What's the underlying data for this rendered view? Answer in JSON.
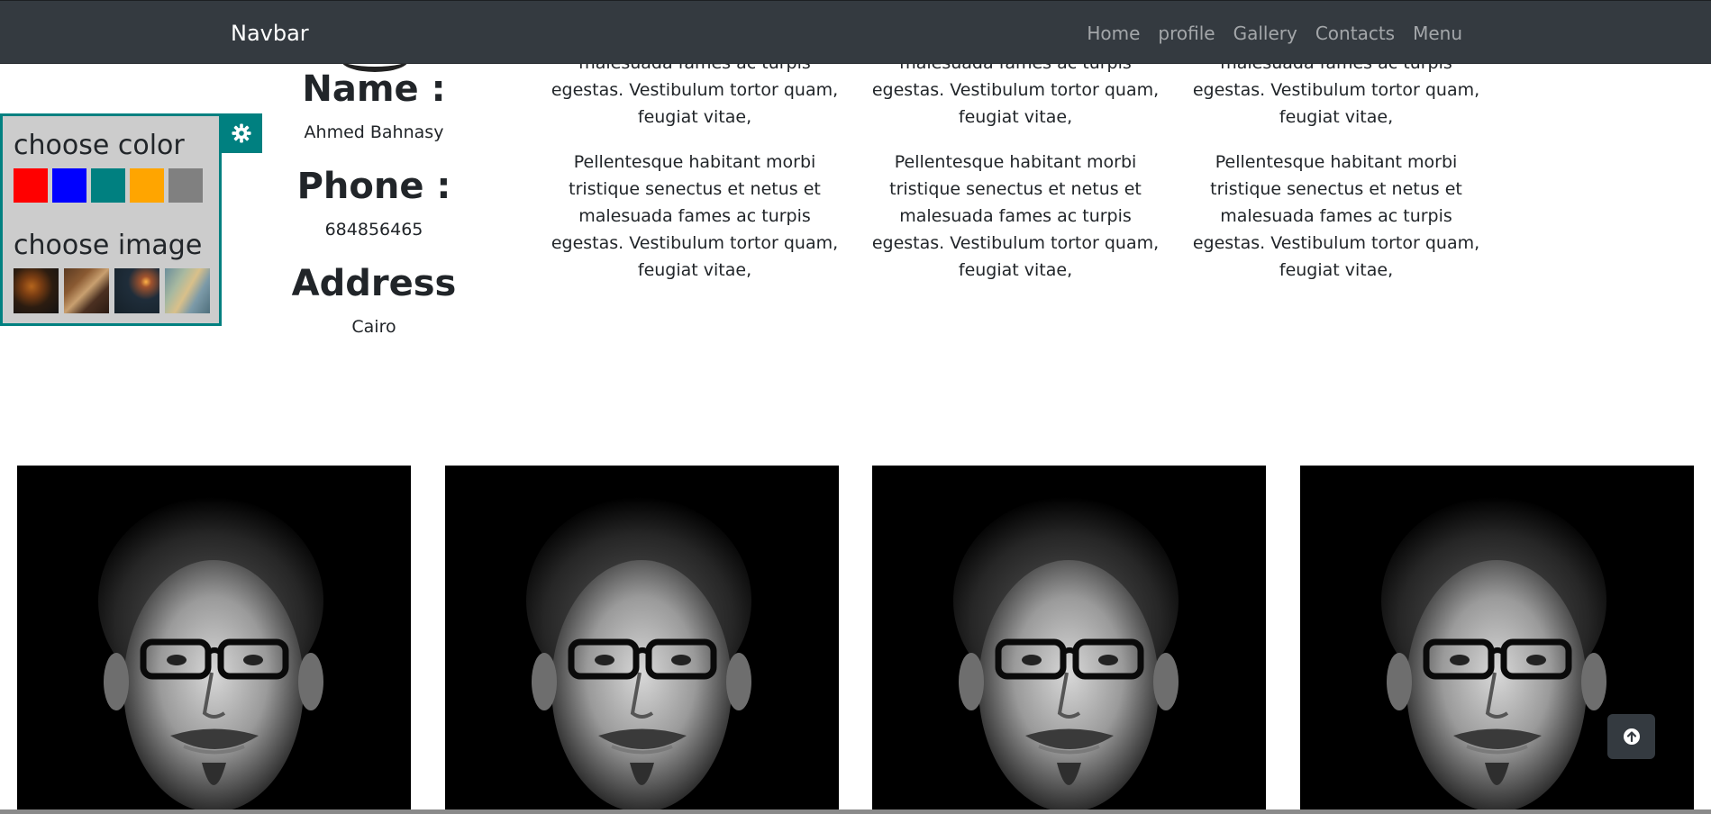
{
  "navbar": {
    "brand": "Navbar",
    "links": [
      "Home",
      "profile",
      "Gallery",
      "Contacts",
      "Menu"
    ]
  },
  "profile": {
    "name_label": "Name :",
    "name_value": "Ahmed Bahnasy",
    "phone_label": "Phone :",
    "phone_value": "684856465",
    "address_label": "Address",
    "address_value": "Cairo"
  },
  "columns": {
    "col1": {
      "para1": "malesuada fames ac turpis egestas. Vestibulum tortor quam, feugiat vitae,",
      "para2": "Pellentesque habitant morbi tristique senectus et netus et malesuada fames ac turpis egestas. Vestibulum tortor quam, feugiat vitae,"
    },
    "col2": {
      "para1": "malesuada fames ac turpis egestas. Vestibulum tortor quam, feugiat vitae,",
      "para2": "Pellentesque habitant morbi tristique senectus et netus et malesuada fames ac turpis egestas. Vestibulum tortor quam, feugiat vitae,"
    },
    "col3": {
      "para1": "tristique senectus et netus et malesuada fames ac turpis egestas. Vestibulum tortor quam, feugiat vitae,",
      "para2": "Pellentesque habitant morbi tristique senectus et netus et malesuada fames ac turpis egestas. Vestibulum tortor quam, feugiat vitae,"
    }
  },
  "settings": {
    "choose_color": "choose color",
    "choose_image": "choose image",
    "colors": [
      "#ff0000",
      "#0000ff",
      "#008080",
      "#ffa500",
      "#808080"
    ],
    "gear_icon": "gear-icon"
  },
  "gallery": {
    "image_count": 4,
    "subject": "portrait-icon"
  },
  "scroll_top": {
    "icon": "arrow-up-circle-icon"
  }
}
